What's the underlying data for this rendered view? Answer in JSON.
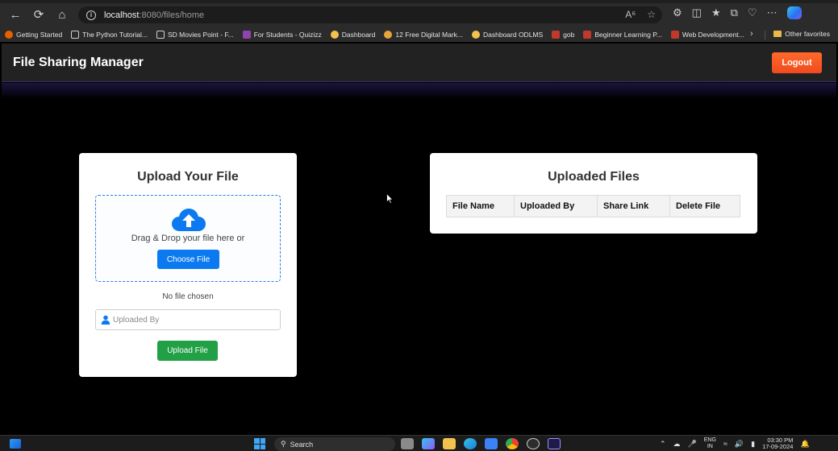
{
  "browser": {
    "url_host": "localhost",
    "url_path": ":8080/files/home",
    "bookmarks": [
      {
        "label": "Getting Started",
        "icon": "firefox-icon",
        "color": "#e66000"
      },
      {
        "label": "The Python Tutorial...",
        "icon": "page-icon",
        "color": "#d0d0d0"
      },
      {
        "label": "SD Movies Point - F...",
        "icon": "page-icon",
        "color": "#d0d0d0"
      },
      {
        "label": "For Students - Quizizz",
        "icon": "quizizz-icon",
        "color": "#8e44ad"
      },
      {
        "label": "Dashboard",
        "icon": "python-icon",
        "color": "#f2c14e"
      },
      {
        "label": "12 Free Digital Mark...",
        "icon": "bookmark-icon",
        "color": "#e8a33a"
      },
      {
        "label": "Dashboard ODLMS",
        "icon": "python-icon",
        "color": "#f2c14e"
      },
      {
        "label": "gob",
        "icon": "gob-icon",
        "color": "#c0392b"
      },
      {
        "label": "Beginner Learning P...",
        "icon": "gm-icon",
        "color": "#c0392b"
      },
      {
        "label": "Web Development...",
        "icon": "gm-icon",
        "color": "#c0392b"
      }
    ],
    "other_favorites": "Other favorites"
  },
  "app": {
    "title": "File Sharing Manager",
    "logout_label": "Logout"
  },
  "upload": {
    "title": "Upload Your File",
    "drop_text": "Drag & Drop your file here or",
    "choose_label": "Choose File",
    "no_file_text": "No file chosen",
    "uploaded_by_placeholder": "Uploaded By",
    "upload_label": "Upload File"
  },
  "files": {
    "title": "Uploaded Files",
    "columns": [
      "File Name",
      "Uploaded By",
      "Share Link",
      "Delete File"
    ]
  },
  "taskbar": {
    "search_label": "Search",
    "lang_top": "ENG",
    "lang_bottom": "IN",
    "time": "03:30 PM",
    "date": "17-09-2024"
  },
  "colors": {
    "accent_blue": "#0b7af0",
    "logout_orange": "#f04a1e",
    "upload_green": "#21a045"
  }
}
